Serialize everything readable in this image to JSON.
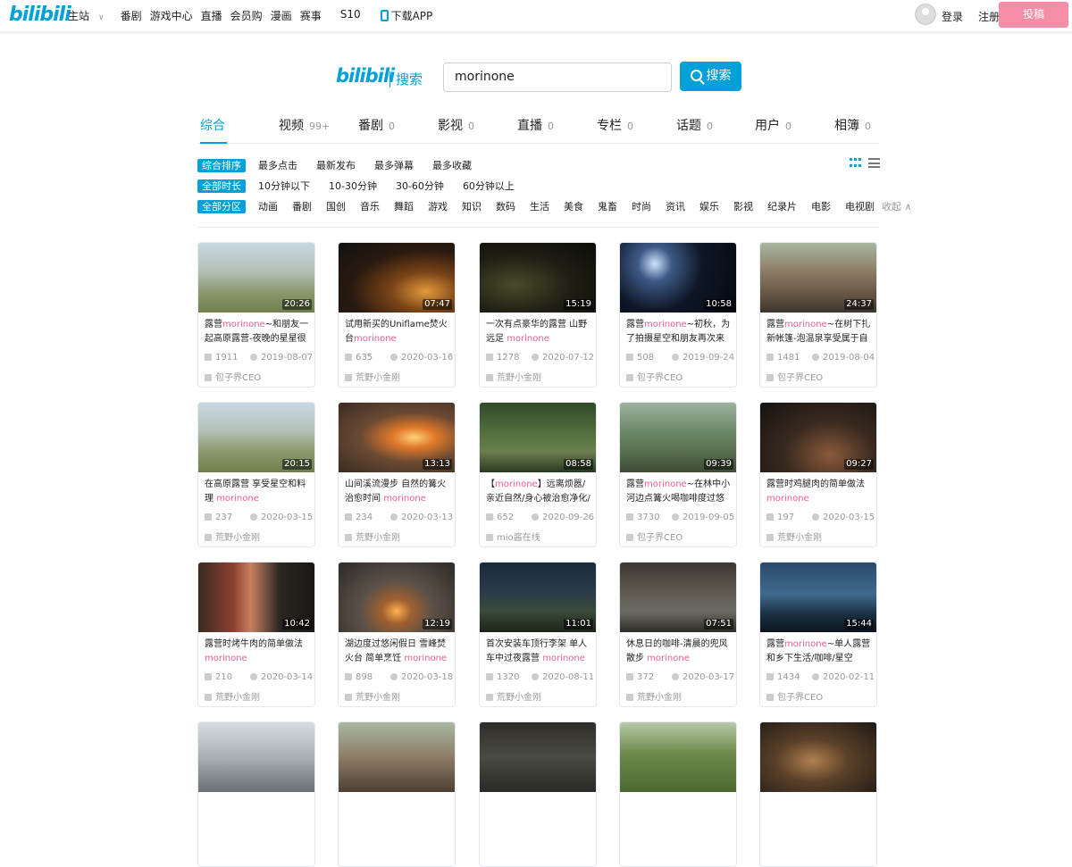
{
  "topbar": {
    "logo": "bilibili",
    "nav": [
      "主站",
      "番剧",
      "游戏中心",
      "直播",
      "会员购",
      "漫画",
      "赛事"
    ],
    "s10": "S10",
    "download": "下载APP",
    "login": "登录",
    "register": "注册",
    "upload": "投稿"
  },
  "search": {
    "logo": "bilibili",
    "label": "搜索",
    "query": "morinone",
    "button": "搜索"
  },
  "tabs": [
    {
      "label": "综合",
      "count": ""
    },
    {
      "label": "视频",
      "count": "99+"
    },
    {
      "label": "番剧",
      "count": "0"
    },
    {
      "label": "影视",
      "count": "0"
    },
    {
      "label": "直播",
      "count": "0"
    },
    {
      "label": "专栏",
      "count": "0"
    },
    {
      "label": "话题",
      "count": "0"
    },
    {
      "label": "用户",
      "count": "0"
    },
    {
      "label": "相簿",
      "count": "0"
    }
  ],
  "filters": {
    "sort": {
      "selected": "综合排序",
      "options": [
        "最多点击",
        "最新发布",
        "最多弹幕",
        "最多收藏"
      ]
    },
    "duration": {
      "selected": "全部时长",
      "options": [
        "10分钟以下",
        "10-30分钟",
        "30-60分钟",
        "60分钟以上"
      ]
    },
    "zone": {
      "selected": "全部分区",
      "options": [
        "动画",
        "番剧",
        "国创",
        "音乐",
        "舞蹈",
        "游戏",
        "知识",
        "数码",
        "生活",
        "美食",
        "鬼畜",
        "时尚",
        "资讯",
        "娱乐",
        "影视",
        "纪录片",
        "电影",
        "电视剧"
      ],
      "collapse": "收起"
    }
  },
  "colors": {
    "accent": "#00a1d6",
    "keyword": "#f25d8e",
    "upload": "#f48ea6"
  },
  "videos": [
    {
      "pre": "露营",
      "kw": "morinone",
      "post": "~和朋友一起高原露营-夜晚的星星很美",
      "duration": "20:26",
      "plays": "1911",
      "date": "2019-08-07",
      "uploader": "包子界CEO",
      "bg": "linear-gradient(180deg,#c9d7e2 0%,#b4c1b8 40%,#8a9a6e 70%,#6f7f4c 100%)"
    },
    {
      "pre": "试用新买的Uniflame焚火台",
      "kw": "morinone",
      "post": "",
      "duration": "07:47",
      "plays": "635",
      "date": "2020-03-16",
      "uploader": "荒野小金刚",
      "bg": "radial-gradient(ellipse at 75% 70%,#e39a3b 0%,#7a4418 28%,#2a1a10 60%,#111 100%)"
    },
    {
      "pre": "一次有点豪华的露营 山野远足 ",
      "kw": "morinone",
      "post": "",
      "duration": "15:19",
      "plays": "1278",
      "date": "2020-07-12",
      "uploader": "荒野小金刚",
      "bg": "radial-gradient(ellipse at 30% 60%,#4a4a2a 0%,#1e1e14 50%,#0b0b08 100%)"
    },
    {
      "pre": "露营",
      "kw": "morinone",
      "post": "~初秋，为了拍摄星空和朋友再次来到",
      "duration": "10:58",
      "plays": "508",
      "date": "2019-09-24",
      "uploader": "包子界CEO",
      "bg": "radial-gradient(circle at 30% 30%,#cfe4ff 0%,#3d5a86 18%,#0e1626 50%,#05080f 100%)"
    },
    {
      "pre": "露营",
      "kw": "morinone",
      "post": "~在树下扎新帐篷-泡温泉享受属于自己",
      "duration": "24:37",
      "plays": "1481",
      "date": "2019-08-04",
      "uploader": "包子界CEO",
      "bg": "linear-gradient(180deg,#a8b6a2 0%,#8c7d66 40%,#6b5a48 70%,#3d362c 100%)"
    },
    {
      "pre": "在高原露营 享受星空和料理 ",
      "kw": "morinone",
      "post": "",
      "duration": "20:15",
      "plays": "237",
      "date": "2020-03-15",
      "uploader": "荒野小金刚",
      "bg": "linear-gradient(180deg,#c9d7e2 0%,#b4c1b8 40%,#8a9a6e 70%,#6f7f4c 100%)"
    },
    {
      "pre": "山间溪流漫步 自然的篝火治愈时间 ",
      "kw": "morinone",
      "post": "",
      "duration": "13:13",
      "plays": "234",
      "date": "2020-03-13",
      "uploader": "荒野小金刚",
      "bg": "radial-gradient(ellipse at 65% 50%,#ffd27a 0%,#e07a2a 20%,#6b4a33 50%,#3a2b22 100%)"
    },
    {
      "pre": "【",
      "kw": "morinone",
      "post": "】远离烦嚣/亲近自然/身心被治愈净化/风",
      "duration": "08:58",
      "plays": "652",
      "date": "2020-09-26",
      "uploader": "mio酱在线",
      "bg": "linear-gradient(180deg,#2e4a2a 0%,#4f6e3c 40%,#6a7e4e 70%,#2a3a22 100%)"
    },
    {
      "pre": "露营",
      "kw": "morinone",
      "post": "~在林中小河边点篝火喝咖啡度过悠闲的",
      "duration": "09:39",
      "plays": "3730",
      "date": "2019-09-05",
      "uploader": "包子界CEO",
      "bg": "linear-gradient(180deg,#9fb2a0 0%,#6c8a6a 40%,#5a6f4e 70%,#3c4a36 100%)"
    },
    {
      "pre": "露营时鸡腿肉的简单做法 ",
      "kw": "morinone",
      "post": "",
      "duration": "09:27",
      "plays": "197",
      "date": "2020-03-15",
      "uploader": "荒野小金刚",
      "bg": "radial-gradient(ellipse at 60% 75%,#8a5a3a 0%,#3a2a20 45%,#151210 100%)"
    },
    {
      "pre": "露营时烤牛肉的简单做法 ",
      "kw": "morinone",
      "post": "",
      "duration": "10:42",
      "plays": "210",
      "date": "2020-03-14",
      "uploader": "荒野小金刚",
      "bg": "linear-gradient(90deg,#3a2a20 0%,#8a4030 30%,#c88060 45%,#2a2622 70%,#1a1816 100%)"
    },
    {
      "pre": "湖边度过悠闲假日 雪峰焚火台 简单烹饪 ",
      "kw": "morinone",
      "post": "",
      "duration": "12:19",
      "plays": "898",
      "date": "2020-03-18",
      "uploader": "荒野小金刚",
      "bg": "radial-gradient(ellipse at 50% 70%,#ffb050 0%,#a06030 18%,#5a5048 45%,#2e2a26 100%)"
    },
    {
      "pre": "首次安装车顶行李架 单人车中过夜露营 ",
      "kw": "morinone",
      "post": "",
      "duration": "11:01",
      "plays": "1320",
      "date": "2020-08-11",
      "uploader": "荒野小金刚",
      "bg": "linear-gradient(180deg,#1a2a3a 0%,#2a3a4a 40%,#3a4a3a 70%,#1c2418 100%)"
    },
    {
      "pre": "休息日的咖啡-清晨的兜风散步 ",
      "kw": "morinone",
      "post": "",
      "duration": "07:51",
      "plays": "372",
      "date": "2020-03-17",
      "uploader": "荒野小金刚",
      "bg": "linear-gradient(180deg,#3a3630 0%,#5e5a50 40%,#6b6a62 70%,#2e2c28 100%)"
    },
    {
      "pre": "露营",
      "kw": "morinone",
      "post": "~单人露营和乡下生活/咖啡/星空",
      "duration": "15:44",
      "plays": "1434",
      "date": "2020-02-11",
      "uploader": "包子界CEO",
      "bg": "linear-gradient(180deg,#2a4a6a 0%,#3e6a8e 45%,#1a2e40 75%,#0e1620 100%)"
    },
    {
      "pre": "",
      "kw": "",
      "post": "",
      "duration": "",
      "plays": "",
      "date": "",
      "uploader": "",
      "bg": "linear-gradient(180deg,#d8dde0 0%,#a8b0b4 50%,#6a7074 100%)"
    },
    {
      "pre": "",
      "kw": "",
      "post": "",
      "duration": "",
      "plays": "",
      "date": "",
      "uploader": "",
      "bg": "linear-gradient(180deg,#a8b6a2 0%,#8c7d66 50%,#4d4034 100%)"
    },
    {
      "pre": "",
      "kw": "",
      "post": "",
      "duration": "",
      "plays": "",
      "date": "",
      "uploader": "",
      "bg": "linear-gradient(180deg,#2e2c28 0%,#4a4a44 50%,#2a2a26 100%)"
    },
    {
      "pre": "",
      "kw": "",
      "post": "",
      "duration": "",
      "plays": "",
      "date": "",
      "uploader": "",
      "bg": "linear-gradient(180deg,#b8c8a8 0%,#6e8a4a 45%,#4a6a30 100%)"
    },
    {
      "pre": "",
      "kw": "",
      "post": "",
      "duration": "",
      "plays": "",
      "date": "",
      "uploader": "",
      "bg": "radial-gradient(ellipse at 45% 55%,#b08050 0%,#5a4028 40%,#1e1a16 100%)"
    }
  ]
}
